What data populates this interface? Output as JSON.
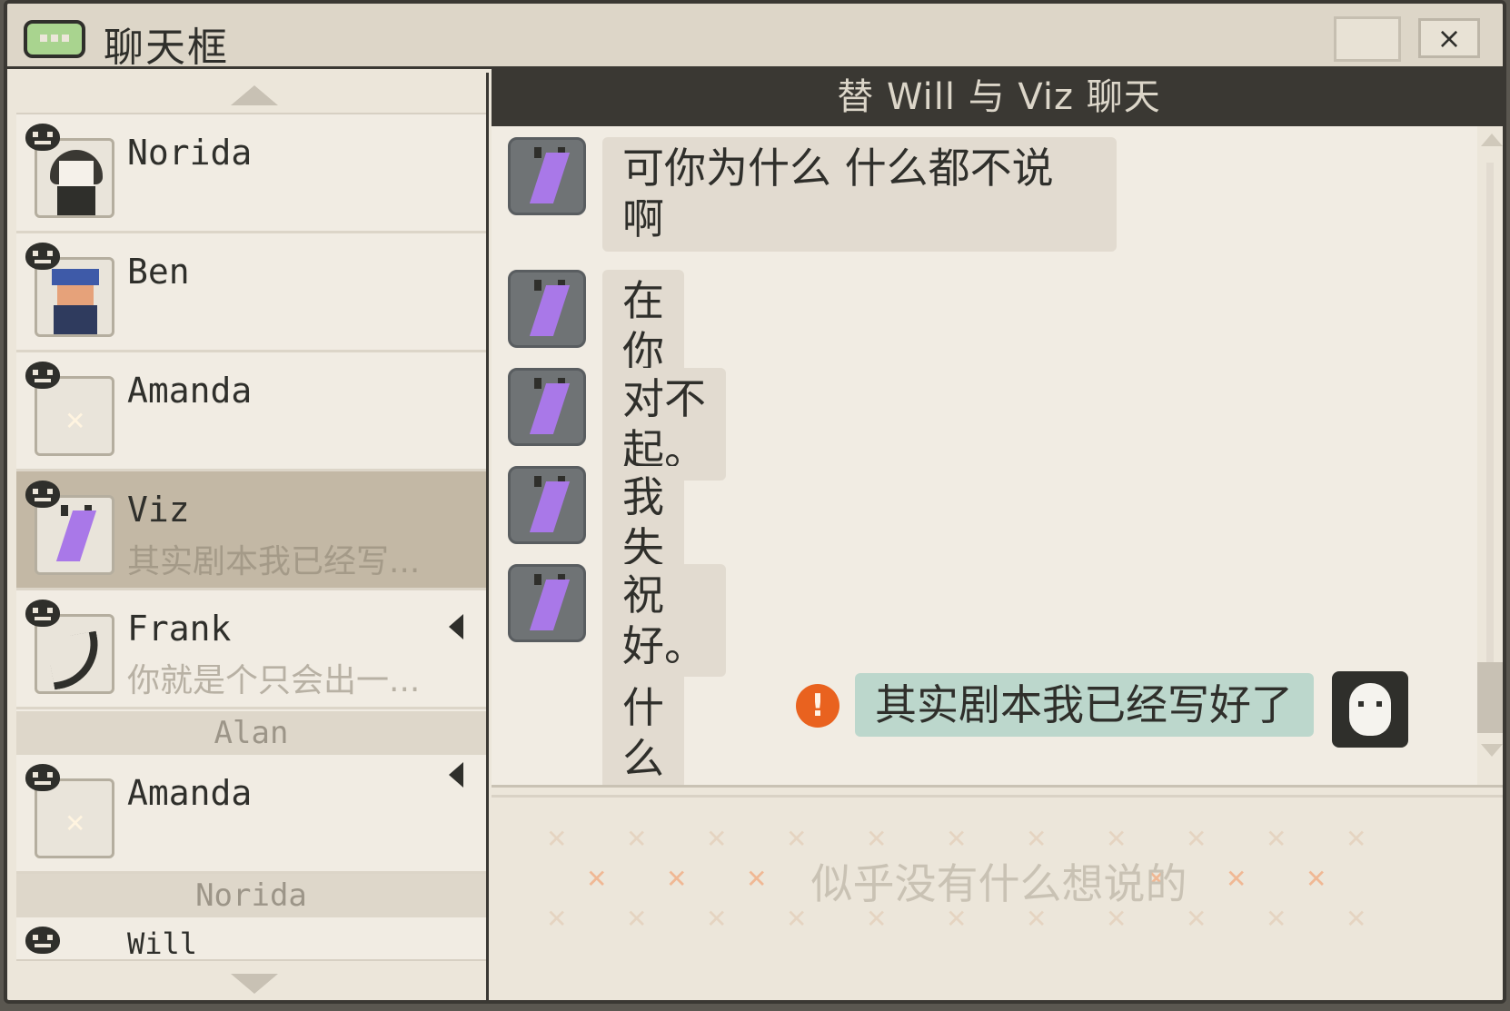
{
  "window": {
    "title": "聊天框",
    "close_label": "×"
  },
  "sidebar": {
    "contacts": [
      {
        "name": "Norida",
        "preview": "",
        "avatar": "norida-avatar",
        "selected": false,
        "unread": false
      },
      {
        "name": "Ben",
        "preview": "",
        "avatar": "ben-avatar",
        "selected": false,
        "unread": false
      },
      {
        "name": "Amanda",
        "preview": "",
        "avatar": "amanda-avatar",
        "selected": false,
        "unread": false
      },
      {
        "name": "Viz",
        "preview": "其实剧本我已经写...",
        "avatar": "viz-avatar",
        "selected": true,
        "unread": false
      },
      {
        "name": "Frank",
        "preview": "你就是个只会出一...",
        "avatar": "frank-avatar",
        "selected": false,
        "unread": true
      }
    ],
    "groups": [
      {
        "header": "Alan",
        "contacts": [
          {
            "name": "Amanda",
            "preview": "",
            "avatar": "amanda-avatar",
            "unread": true
          }
        ]
      },
      {
        "header": "Norida",
        "contacts": [
          {
            "name": "Will",
            "preview": "",
            "avatar": "will-avatar",
            "unread": false
          }
        ]
      }
    ]
  },
  "chat": {
    "header": "替 Will 与 Viz 聊天",
    "messages": [
      {
        "from": "Viz",
        "direction": "in",
        "text": "可你为什么 什么都不说",
        "text_line2": "啊"
      },
      {
        "from": "Viz",
        "direction": "in",
        "text": "在你心里 我到底是什么"
      },
      {
        "from": "Viz",
        "direction": "in",
        "text": "对不起。"
      },
      {
        "from": "Viz",
        "direction": "in",
        "text": "我失态了"
      },
      {
        "from": "Viz",
        "direction": "in",
        "text": "祝好。"
      },
      {
        "from": "Will",
        "direction": "out",
        "text": "其实剧本我已经写好了",
        "status_icon": "alert-icon",
        "status_glyph": "!"
      }
    ],
    "input_placeholder": "似乎没有什么想说的"
  },
  "colors": {
    "header_bg": "#3a3833",
    "outgoing_bubble": "#bcd7cc",
    "incoming_bubble": "#e2dbd0",
    "selected_contact": "#c3b8a5",
    "alert": "#e9621f"
  }
}
